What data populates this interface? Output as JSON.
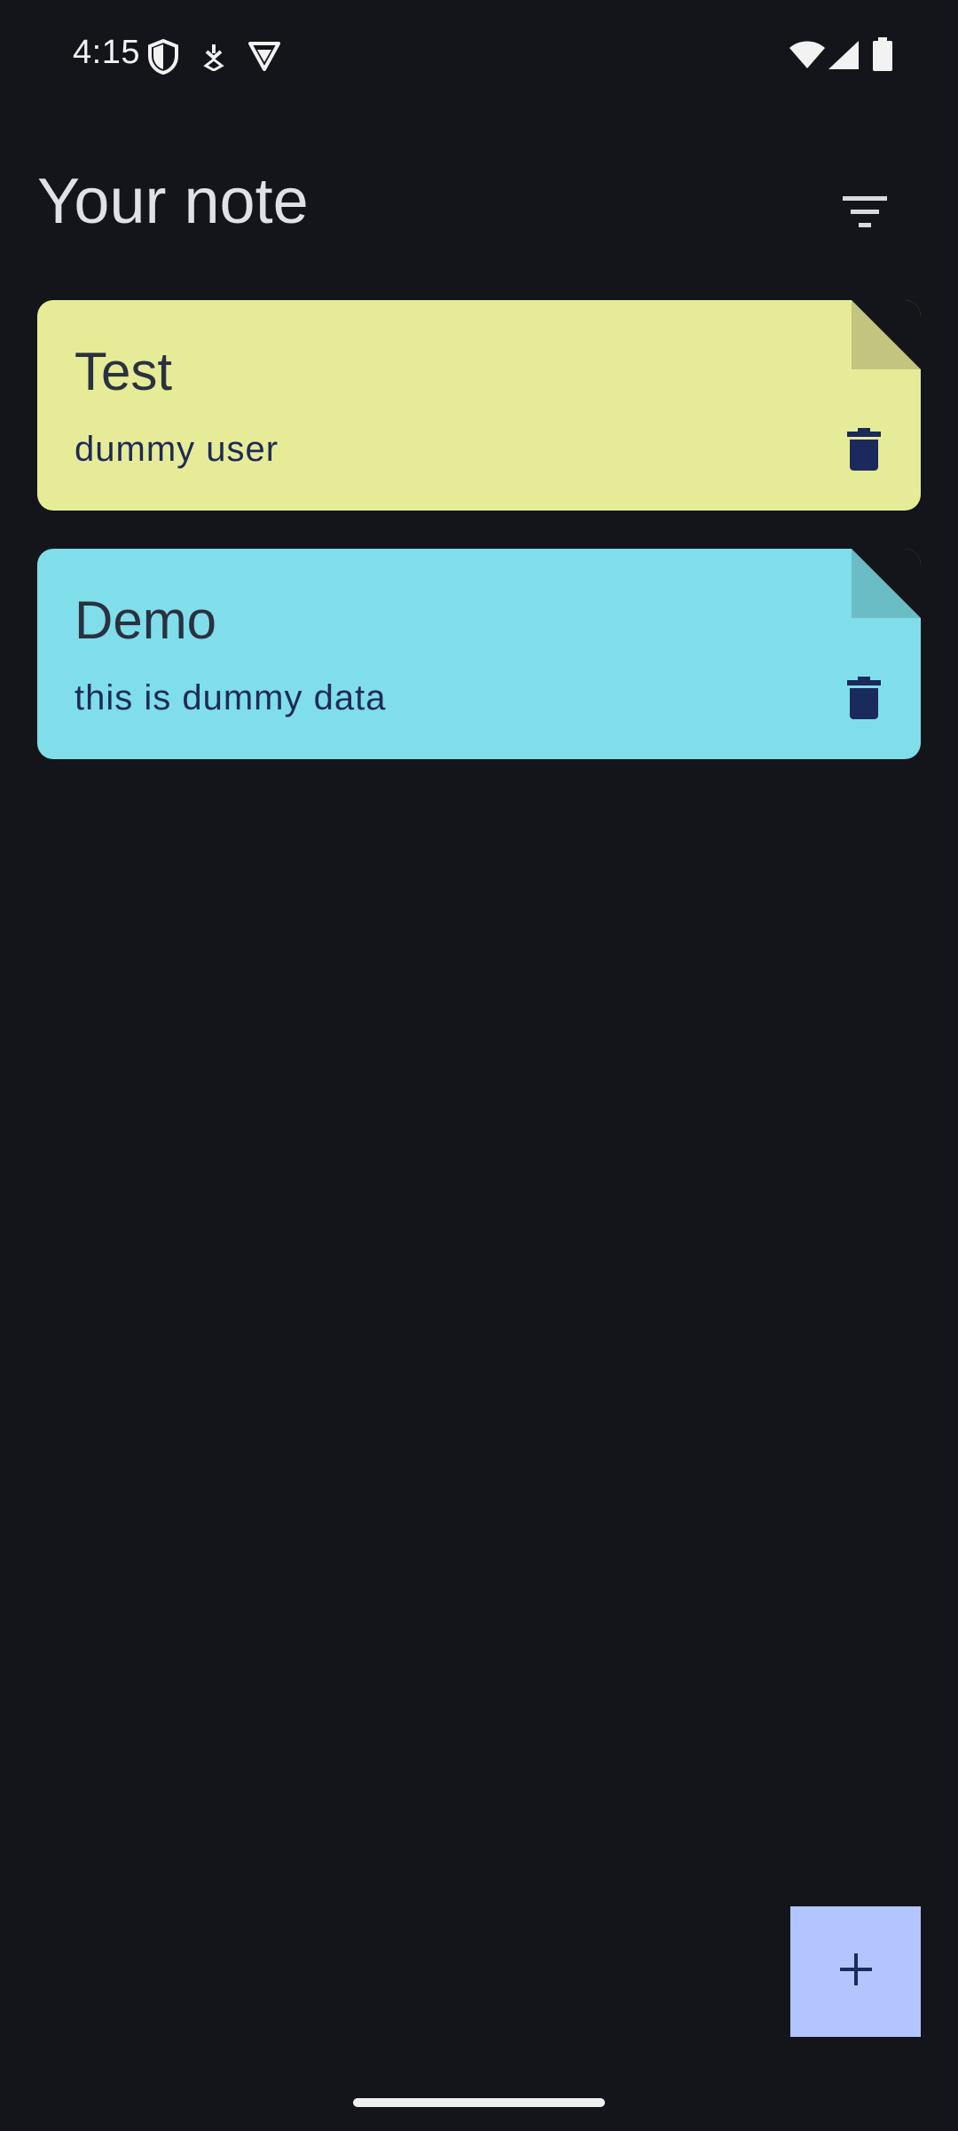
{
  "status_bar": {
    "time": "4:15",
    "icons": [
      "shield-icon",
      "download-icon",
      "vpn-icon",
      "wifi-icon",
      "signal-icon",
      "battery-icon"
    ]
  },
  "header": {
    "title": "Your note",
    "filter_icon": "filter-icon"
  },
  "notes": [
    {
      "title": "Test",
      "content": "dummy user",
      "color": "#e6eb98",
      "fold_color": "#c2c47f",
      "delete_icon": "trash-icon"
    },
    {
      "title": "Demo",
      "content": "this is dummy data",
      "color": "#7fdeea",
      "fold_color": "#6abcc5",
      "delete_icon": "trash-icon"
    }
  ],
  "fab": {
    "icon": "plus-icon",
    "color": "#b3c5ff"
  },
  "colors": {
    "background": "#13151a",
    "text_dark": "#2a3140",
    "icon_dark": "#1a2a5c"
  }
}
